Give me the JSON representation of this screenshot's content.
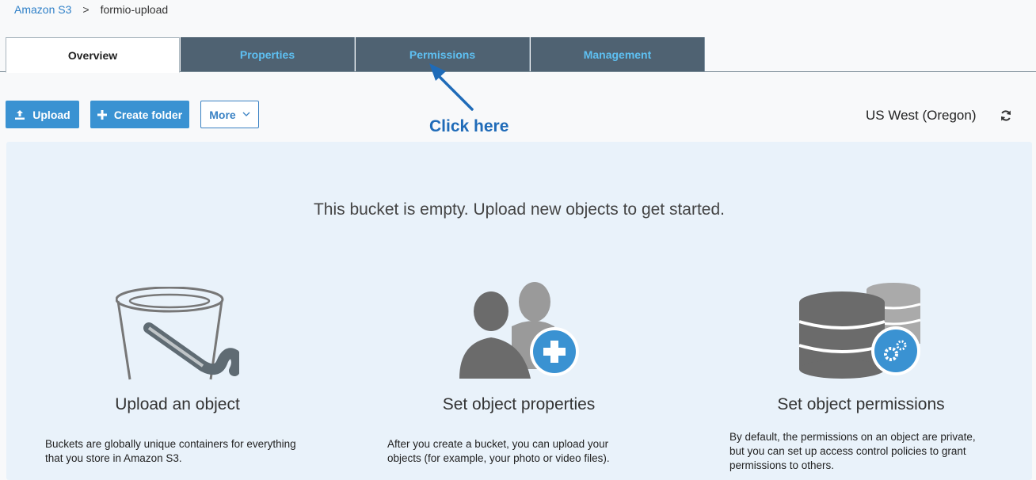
{
  "breadcrumb": {
    "root": "Amazon S3",
    "separator": ">",
    "current": "formio-upload"
  },
  "tabs": [
    {
      "label": "Overview",
      "active": true
    },
    {
      "label": "Properties",
      "active": false
    },
    {
      "label": "Permissions",
      "active": false
    },
    {
      "label": "Management",
      "active": false
    }
  ],
  "toolbar": {
    "upload_label": "Upload",
    "create_folder_label": "Create folder",
    "more_label": "More",
    "region": "US West (Oregon)"
  },
  "annotation": {
    "text": "Click here"
  },
  "panel": {
    "empty_message": "This bucket is empty. Upload new objects to get started.",
    "cards": [
      {
        "title": "Upload an object",
        "icon": "bucket-icon",
        "desc_lines": [
          "Buckets are globally unique containers for everything",
          "that you store in Amazon S3."
        ]
      },
      {
        "title": "Set object properties",
        "icon": "users-add-icon",
        "desc_lines": [
          "After you create a bucket, you can upload your",
          "objects (for example, your photo or video files)."
        ]
      },
      {
        "title": "Set object permissions",
        "icon": "database-settings-icon",
        "desc_lines": [
          "By default, the permissions on an object are private,",
          "but you can set up access control policies to grant",
          "permissions to others."
        ]
      }
    ]
  },
  "colors": {
    "accent": "#3a92d2",
    "tab_bg": "#4f6272",
    "tab_text": "#5ec0f2",
    "panel_bg": "#e9f2fa",
    "annotation": "#1f6bb8"
  }
}
